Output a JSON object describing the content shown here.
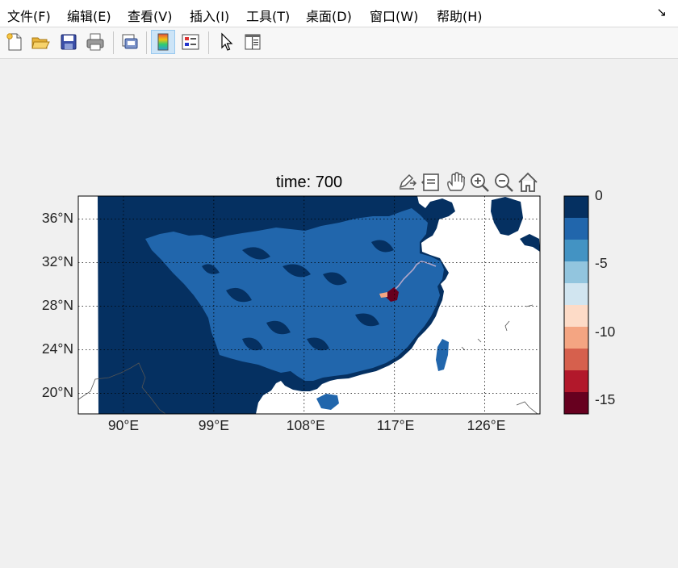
{
  "menu": {
    "items": [
      "文件(F)",
      "编辑(E)",
      "查看(V)",
      "插入(I)",
      "工具(T)",
      "桌面(D)",
      "窗口(W)",
      "帮助(H)"
    ],
    "arrow_icon": "dock-arrow-icon"
  },
  "toolbar": {
    "buttons": [
      "new-figure-icon",
      "open-file-icon",
      "save-icon",
      "print-icon",
      "print-preview-icon",
      "colorbar-icon",
      "legend-icon",
      "edit-plot-pointer-icon",
      "property-inspector-icon"
    ],
    "active": "colorbar-icon"
  },
  "axes_toolbar": {
    "buttons": [
      "export-icon",
      "data-tips-icon",
      "pan-hand-icon",
      "zoom-in-icon",
      "zoom-out-icon",
      "home-icon"
    ]
  },
  "figure": {
    "title": "time: 700"
  },
  "chart_data": {
    "type": "heatmap",
    "title": "time: 700",
    "xlabel": "",
    "ylabel": "",
    "x_ticks": [
      "90°E",
      "99°E",
      "108°E",
      "117°E",
      "126°E"
    ],
    "x_tick_values": [
      90,
      99,
      108,
      117,
      126
    ],
    "y_ticks": [
      "36°N",
      "32°N",
      "28°N",
      "24°N",
      "20°N"
    ],
    "y_tick_values": [
      36,
      32,
      28,
      24,
      20
    ],
    "xlim": [
      85.5,
      131.5
    ],
    "ylim": [
      18.1,
      38.1
    ],
    "grid": true,
    "grid_style": "dotted",
    "colorbar": {
      "position": "right",
      "range": [
        -16,
        0
      ],
      "tick_labels": [
        "0",
        "-5",
        "-10",
        "-15"
      ],
      "tick_values": [
        0,
        -5,
        -10,
        -15
      ],
      "colors": [
        "#053061",
        "#2166ac",
        "#4393c3",
        "#92c5de",
        "#d1e5f0",
        "#fddbc7",
        "#f4a582",
        "#d6604d",
        "#b2182b",
        "#67001f"
      ]
    },
    "dominant_value_range": [
      -1.6,
      0
    ],
    "anomaly": {
      "lon": 116.5,
      "lat": 29.3,
      "value_range": [
        -16,
        -12
      ]
    }
  }
}
